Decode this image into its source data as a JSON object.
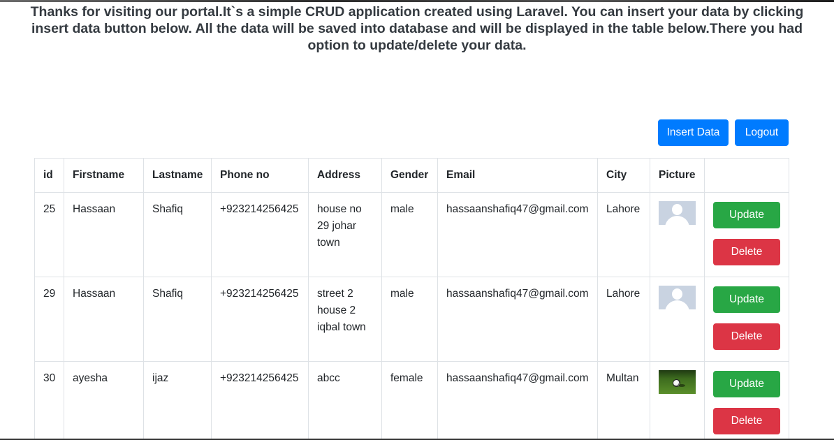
{
  "intro_text": "Thanks for visiting our portal.It`s a simple CRUD application created using Laravel. You can insert your data by clicking insert data button below. All the data will be saved into database and will be displayed in the table below.There you had option to update/delete your data.",
  "actions": {
    "insert_label": "Insert Data",
    "logout_label": "Logout"
  },
  "table": {
    "headers": {
      "id": "id",
      "firstname": "Firstname",
      "lastname": "Lastname",
      "phone": "Phone no",
      "address": "Address",
      "gender": "Gender",
      "email": "Email",
      "city": "City",
      "picture": "Picture",
      "actions": ""
    },
    "rows": [
      {
        "id": "25",
        "firstname": "Hassaan",
        "lastname": "Shafiq",
        "phone": "+923214256425",
        "address": "house no 29 johar town",
        "gender": "male",
        "email": "hassaanshafiq47@gmail.com",
        "city": "Lahore",
        "picture": "default-avatar-icon",
        "update_label": "Update",
        "delete_label": "Delete"
      },
      {
        "id": "29",
        "firstname": "Hassaan",
        "lastname": "Shafiq",
        "phone": "+923214256425",
        "address": "street 2 house 2 iqbal town",
        "gender": "male",
        "email": "hassaanshafiq47@gmail.com",
        "city": "Lahore",
        "picture": "default-avatar-icon",
        "update_label": "Update",
        "delete_label": "Delete"
      },
      {
        "id": "30",
        "firstname": "ayesha",
        "lastname": "ijaz",
        "phone": "+923214256425",
        "address": "abcc",
        "gender": "female",
        "email": "hassaanshafiq47@gmail.com",
        "city": "Multan",
        "picture": "football-photo",
        "update_label": "Update",
        "delete_label": "Delete"
      }
    ]
  },
  "colors": {
    "primary": "#007bff",
    "success": "#28a745",
    "danger": "#dc3545",
    "table_border": "#dee2e6",
    "avatar_placeholder": "#c9d3e1"
  }
}
